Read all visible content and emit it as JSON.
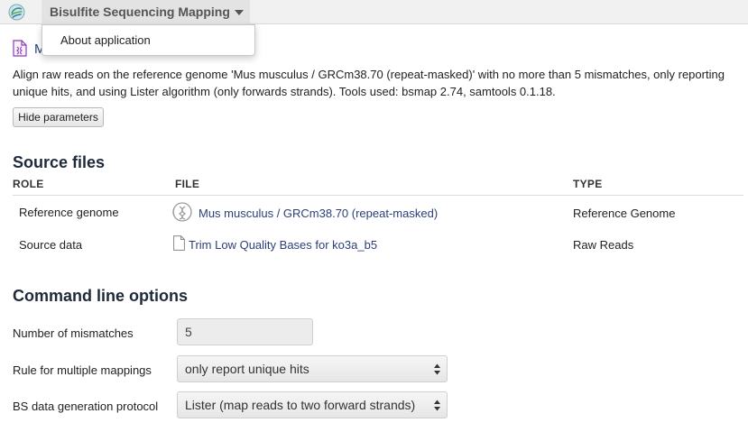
{
  "app": {
    "name": "Bisulfite Sequencing Mapping",
    "menu_items": [
      "About application"
    ]
  },
  "page": {
    "title": "M",
    "description": "Align raw reads on the reference genome 'Mus musculus / GRCm38.70 (repeat-masked)' with no more than 5 mismatches, only reporting unique hits, and using Lister algorithm (only forwards strands). Tools used: bsmap 2.74, samtools 0.1.18.",
    "hide_parameters_label": "Hide parameters"
  },
  "source_files": {
    "heading": "Source files",
    "columns": [
      "ROLE",
      "FILE",
      "TYPE"
    ],
    "rows": [
      {
        "role": "Reference genome",
        "file": "Mus musculus / GRCm38.70 (repeat-masked)",
        "type": "Reference Genome",
        "icon": "genome-icon"
      },
      {
        "role": "Source data",
        "file": "Trim Low Quality Bases for ko3a_b5",
        "type": "Raw Reads",
        "icon": "file-icon"
      }
    ]
  },
  "options": {
    "heading": "Command line options",
    "items": [
      {
        "label": "Number of mismatches",
        "value": "5",
        "kind": "input"
      },
      {
        "label": "Rule for multiple mappings",
        "value": "only report unique hits",
        "kind": "select"
      },
      {
        "label": "BS data generation protocol",
        "value": "Lister (map reads to two forward strands)",
        "kind": "select"
      }
    ]
  },
  "colors": {
    "link": "#2b3f7a",
    "accent_icon": "#8a3fb0"
  }
}
